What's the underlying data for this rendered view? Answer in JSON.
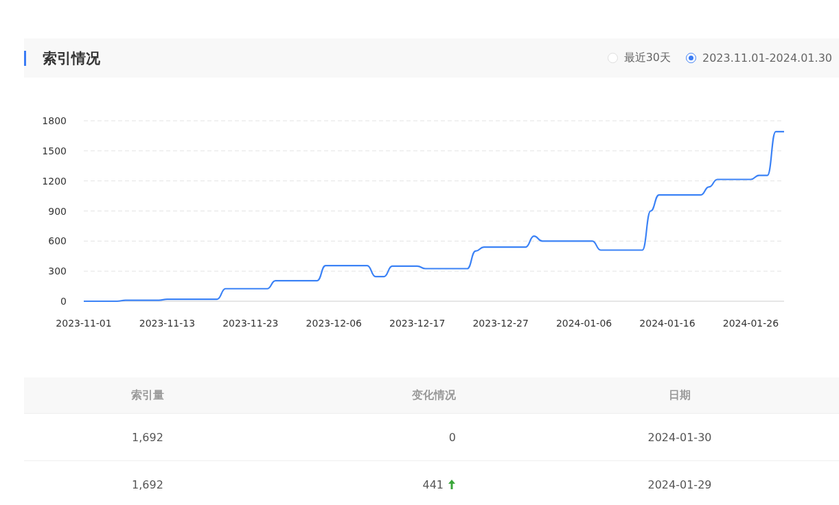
{
  "header": {
    "title": "索引情况",
    "range_options": [
      {
        "label": "最近30天",
        "selected": false
      },
      {
        "label": "2023.11.01-2024.01.30",
        "selected": true
      }
    ]
  },
  "chart_data": {
    "type": "line",
    "categories": [
      "2023-11-01",
      null,
      null,
      null,
      null,
      null,
      null,
      null,
      null,
      null,
      "2023-11-13",
      null,
      null,
      null,
      null,
      null,
      null,
      null,
      null,
      null,
      "2023-11-23",
      null,
      null,
      null,
      null,
      null,
      null,
      null,
      null,
      null,
      "2023-12-06",
      null,
      null,
      null,
      null,
      null,
      null,
      null,
      null,
      null,
      "2023-12-17",
      null,
      null,
      null,
      null,
      null,
      null,
      null,
      null,
      null,
      "2023-12-27",
      null,
      null,
      null,
      null,
      null,
      null,
      null,
      null,
      null,
      "2024-01-06",
      null,
      null,
      null,
      null,
      null,
      null,
      null,
      null,
      null,
      "2024-01-16",
      null,
      null,
      null,
      null,
      null,
      null,
      null,
      null,
      null,
      "2024-01-26",
      null,
      null,
      null,
      null
    ],
    "series": [
      {
        "color": "#3b82f6",
        "values": [
          0,
          0,
          0,
          0,
          0,
          10,
          10,
          10,
          10,
          10,
          20,
          20,
          20,
          20,
          20,
          20,
          20,
          125,
          125,
          125,
          125,
          125,
          125,
          205,
          205,
          205,
          205,
          205,
          205,
          355,
          355,
          355,
          355,
          355,
          355,
          245,
          245,
          350,
          350,
          350,
          350,
          325,
          325,
          325,
          325,
          325,
          325,
          500,
          540,
          540,
          540,
          540,
          540,
          540,
          650,
          600,
          600,
          600,
          600,
          600,
          600,
          600,
          510,
          510,
          510,
          510,
          510,
          510,
          900,
          1060,
          1060,
          1060,
          1060,
          1060,
          1060,
          1140,
          1215,
          1215,
          1215,
          1215,
          1215,
          1255,
          1255,
          1692,
          1692
        ]
      }
    ],
    "ylim": [
      0,
      1800
    ],
    "grid": true,
    "yticks": [
      0,
      300,
      600,
      900,
      1200,
      1500,
      1800
    ]
  },
  "table": {
    "columns": [
      "索引量",
      "变化情况",
      "日期"
    ],
    "rows": [
      {
        "count": "1,692",
        "change": "0",
        "kind": "flat",
        "date": "2024-01-30"
      },
      {
        "count": "1,692",
        "change": "441",
        "kind": "up",
        "date": "2024-01-29"
      }
    ]
  }
}
